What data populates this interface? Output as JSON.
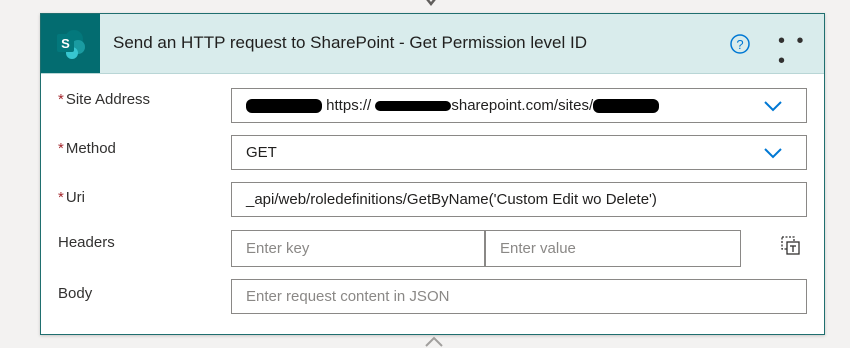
{
  "card": {
    "title": "Send an HTTP request to SharePoint - Get Permission level ID"
  },
  "fields": {
    "site_address": {
      "label": "Site Address",
      "value_visible": "https://",
      "value_visible_2": "sharepoint.com/sites/"
    },
    "method": {
      "label": "Method",
      "value": "GET"
    },
    "uri": {
      "label": "Uri",
      "value": "_api/web/roledefinitions/GetByName('Custom Edit wo Delete')"
    },
    "headers": {
      "label": "Headers",
      "key_placeholder": "Enter key",
      "value_placeholder": "Enter value"
    },
    "body": {
      "label": "Body",
      "placeholder": "Enter request content in JSON"
    }
  },
  "required_marker": "*",
  "colors": {
    "header_bg": "#d9ecec",
    "brand": "#036c70",
    "accent_blue": "#0078d4",
    "required": "#a4262c",
    "border": "#8a8886"
  },
  "icons": {
    "connector": "down-arrow-icon",
    "app": "sharepoint-icon",
    "help": "help-icon",
    "more": "more-options-icon",
    "dropdown": "chevron-down-icon",
    "switch_mode": "switch-to-text-mode-icon"
  }
}
